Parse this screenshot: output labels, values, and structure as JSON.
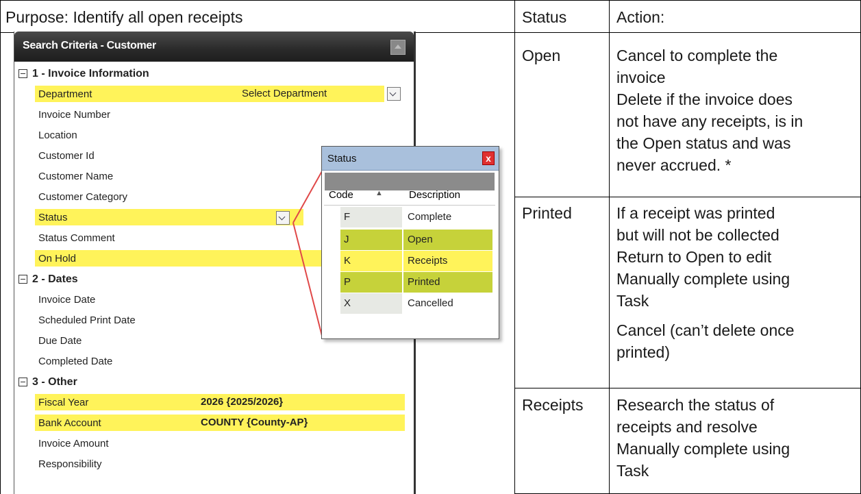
{
  "header": {
    "purpose": "Purpose: Identify all open receipts",
    "status_col": "Status",
    "action_col": "Action:"
  },
  "rows": [
    {
      "status": "Open",
      "actions": [
        "Cancel to complete the",
        "invoice",
        "Delete if the invoice does",
        "not have any receipts, is in",
        "the Open status and was",
        "never accrued. *"
      ]
    },
    {
      "status": "Printed",
      "actions": [
        "If a receipt was printed",
        "but will not be collected",
        "Return to Open to edit",
        "Manually complete using",
        "Task",
        "Cancel (can’t delete once",
        "printed)"
      ]
    },
    {
      "status": "Receipts",
      "actions": [
        "Research the status of",
        "receipts and resolve",
        "Manually complete using",
        "Task"
      ]
    }
  ],
  "screenshot": {
    "title": "Search Criteria - Customer",
    "groups": [
      {
        "label": "1 - Invoice Information"
      },
      {
        "label": "2 - Dates"
      },
      {
        "label": "3 - Other"
      }
    ],
    "fields": {
      "department": "Department",
      "department_value": "Select Department",
      "invoice_number": "Invoice Number",
      "location": "Location",
      "customer_id": "Customer Id",
      "customer_name": "Customer Name",
      "customer_category": "Customer Category",
      "status": "Status",
      "status_comment": "Status Comment",
      "on_hold": "On Hold",
      "invoice_date": "Invoice Date",
      "scheduled_print_date": "Scheduled Print Date",
      "due_date": "Due Date",
      "completed_date": "Completed Date",
      "fiscal_year": "Fiscal Year",
      "fiscal_year_value": "2026 {2025/2026}",
      "bank_account": "Bank Account",
      "bank_account_value": "COUNTY {County-AP}",
      "invoice_amount": "Invoice Amount",
      "responsibility": "Responsibility"
    },
    "popup": {
      "title": "Status",
      "col_code": "Code",
      "col_desc": "Description",
      "sort_glyph": "▲",
      "close_glyph": "x",
      "items": [
        {
          "code": "F",
          "desc": "Complete"
        },
        {
          "code": "J",
          "desc": "Open"
        },
        {
          "code": "K",
          "desc": "Receipts"
        },
        {
          "code": "P",
          "desc": "Printed"
        },
        {
          "code": "X",
          "desc": "Cancelled"
        }
      ]
    }
  },
  "colors": {
    "highlight": "#fff35a",
    "selected": "#c6d23a",
    "callout": "#e04848"
  }
}
